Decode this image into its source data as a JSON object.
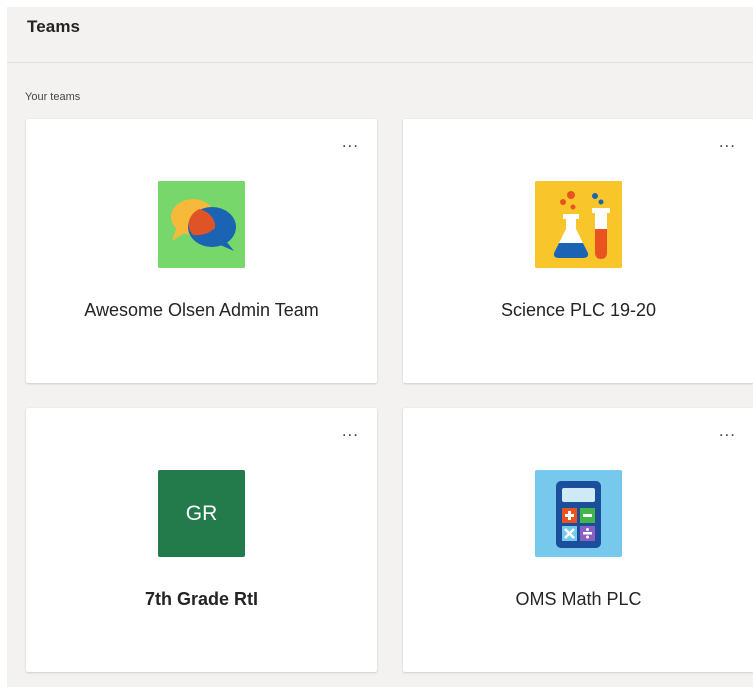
{
  "header": {
    "title": "Teams"
  },
  "section": {
    "label": "Your teams"
  },
  "teams": [
    {
      "name": "Awesome Olsen Admin Team",
      "icon": "chat-bubbles-icon",
      "tile_color": "#77d76b",
      "more_label": "..."
    },
    {
      "name": "Science PLC 19-20",
      "icon": "science-flask-icon",
      "tile_color": "#f8c62b",
      "more_label": "..."
    },
    {
      "name": "7th Grade RtI",
      "icon": "initials-tile",
      "initials": "GR",
      "tile_color": "#237b4b",
      "more_label": "..."
    },
    {
      "name": "OMS Math PLC",
      "icon": "calculator-icon",
      "tile_color": "#76c9ec",
      "more_label": "..."
    }
  ]
}
